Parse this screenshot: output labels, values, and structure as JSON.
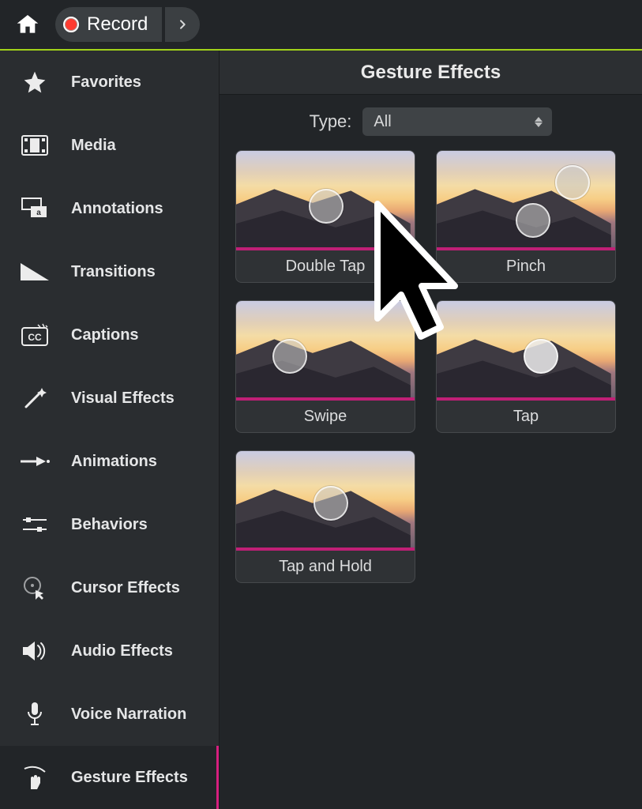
{
  "topbar": {
    "record_label": "Record"
  },
  "sidebar": {
    "items": [
      {
        "label": "Favorites"
      },
      {
        "label": "Media"
      },
      {
        "label": "Annotations"
      },
      {
        "label": "Transitions"
      },
      {
        "label": "Captions"
      },
      {
        "label": "Visual Effects"
      },
      {
        "label": "Animations"
      },
      {
        "label": "Behaviors"
      },
      {
        "label": "Cursor Effects"
      },
      {
        "label": "Audio Effects"
      },
      {
        "label": "Voice Narration"
      },
      {
        "label": "Gesture Effects"
      }
    ]
  },
  "panel": {
    "title": "Gesture Effects",
    "type_label": "Type:",
    "type_value": "All"
  },
  "effects": [
    {
      "label": "Double Tap"
    },
    {
      "label": "Pinch"
    },
    {
      "label": "Swipe"
    },
    {
      "label": "Tap"
    },
    {
      "label": "Tap and Hold"
    }
  ]
}
